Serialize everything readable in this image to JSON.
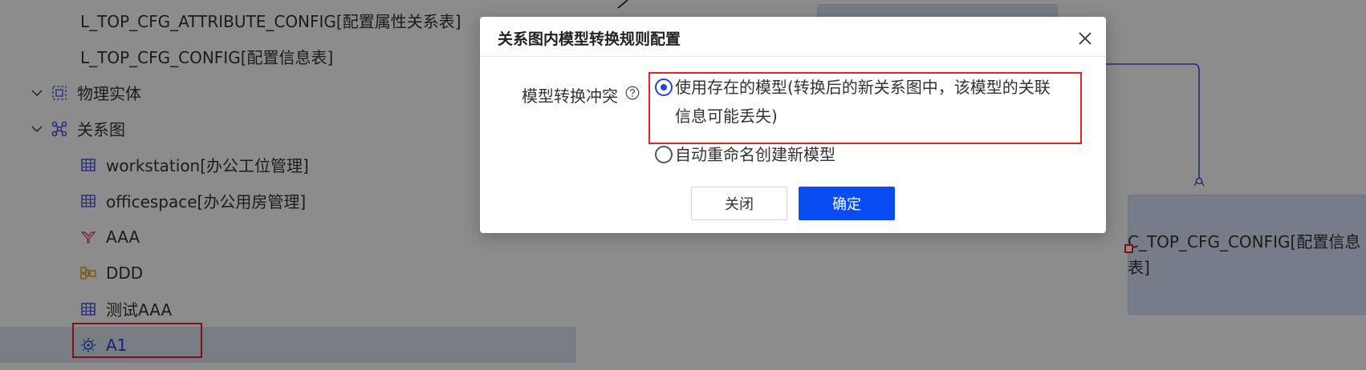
{
  "sidebar": {
    "items": [
      {
        "label": "L_TOP_CFG_ATTRIBUTE_CONFIG[配置属性关系表]",
        "icon": "table-icon"
      },
      {
        "label": "L_TOP_CFG_CONFIG[配置信息表]",
        "icon": "table-icon"
      },
      {
        "label": "物理实体",
        "icon": "physical-entity-icon",
        "expanded": true
      },
      {
        "label": "关系图",
        "icon": "relationship-graph-icon",
        "expanded": true
      },
      {
        "label": "workstation[办公工位管理]",
        "icon": "table-icon"
      },
      {
        "label": "officespace[办公用房管理]",
        "icon": "table-icon"
      },
      {
        "label": "AAA",
        "icon": "funnel-icon"
      },
      {
        "label": "DDD",
        "icon": "cluster-icon"
      },
      {
        "label": "测试AAA",
        "icon": "table-icon"
      },
      {
        "label": "A1",
        "icon": "lightbulb-icon",
        "selected": true
      }
    ]
  },
  "canvas": {
    "entity_label": "C_TOP_CFG_CONFIG[配置信息表]"
  },
  "modal": {
    "title": "关系图内模型转换规则配置",
    "field_label": "模型转换冲突",
    "options": [
      {
        "label_line1": "使用存在的模型(转换后的新关系图中，该模型的关联",
        "label_line2": "信息可能丢失)",
        "checked": true
      },
      {
        "label": "自动重命名创建新模型",
        "checked": false
      }
    ],
    "cancel_label": "关闭",
    "ok_label": "确定"
  },
  "colors": {
    "primary": "#0a4cf4",
    "highlight_border": "#e4202a",
    "selected_row": "#dde3f0"
  }
}
